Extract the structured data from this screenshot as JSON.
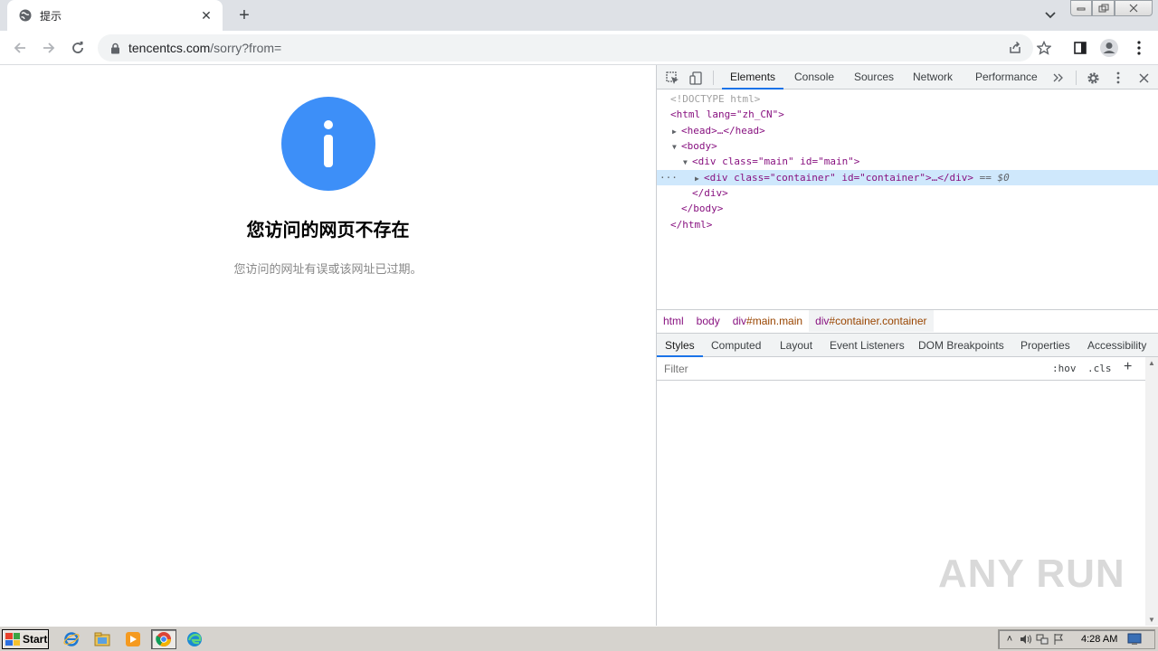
{
  "browser": {
    "tab": {
      "title": "提示",
      "favicon": "globe-icon"
    },
    "url": {
      "host": "tencentcs.com",
      "path": "/sorry?from="
    }
  },
  "page": {
    "icon": "info-icon",
    "title": "您访问的网页不存在",
    "subtitle": "您访问的网址有误或该网址已过期。",
    "accent_color": "#3d8ff8"
  },
  "devtools": {
    "tabs": [
      "Elements",
      "Console",
      "Sources",
      "Network",
      "Performance"
    ],
    "active_tab": "Elements",
    "dom": {
      "doctype": "<!DOCTYPE html>",
      "html_open": "<html lang=\"zh_CN\">",
      "head": "<head>…</head>",
      "body_open": "<body>",
      "div_main_open": "<div class=\"main\" id=\"main\">",
      "div_container": "<div class=\"container\" id=\"container\">…</div>",
      "selected_marker": "== $0",
      "div_close": "</div>",
      "body_close": "</body>",
      "html_close": "</html>"
    },
    "breadcrumbs": [
      {
        "tag": "html",
        "cls": ""
      },
      {
        "tag": "body",
        "cls": ""
      },
      {
        "tag": "div",
        "cls": "#main.main"
      },
      {
        "tag": "div",
        "cls": "#container.container"
      }
    ],
    "styles_tabs": [
      "Styles",
      "Computed",
      "Layout",
      "Event Listeners",
      "DOM Breakpoints",
      "Properties",
      "Accessibility"
    ],
    "filter": {
      "placeholder": "Filter",
      "hov": ":hov",
      "cls": ".cls",
      "add": "+"
    }
  },
  "watermark": "ANY RUN",
  "taskbar": {
    "start_label": "Start",
    "apps": [
      "ie-icon",
      "explorer-icon",
      "media-player-icon",
      "chrome-icon",
      "edge-icon"
    ],
    "clock": "4:28 AM"
  }
}
